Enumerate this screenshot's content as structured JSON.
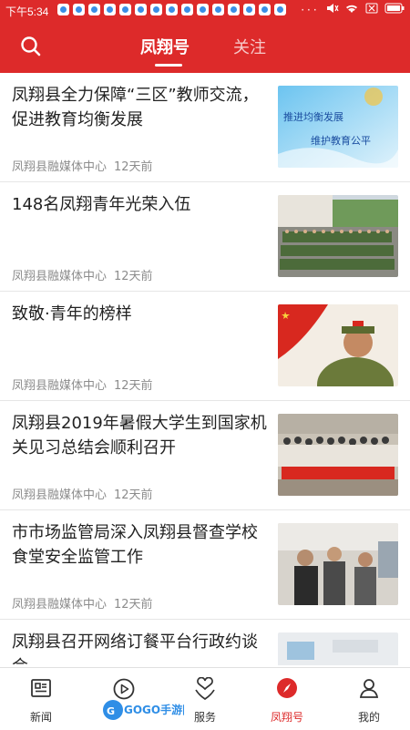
{
  "status_bar": {
    "time": "下午5:34",
    "notification_icons": [
      "app-notification-icon",
      "app-notification-icon",
      "app-notification-icon",
      "app-notification-icon",
      "app-notification-icon",
      "app-notification-icon",
      "app-notification-icon",
      "app-notification-icon",
      "app-notification-icon",
      "app-notification-icon",
      "app-notification-icon",
      "app-notification-icon",
      "app-notification-icon"
    ],
    "right_icons": [
      "more-icon",
      "mute-icon",
      "wifi-icon",
      "signal-off-icon",
      "battery-icon"
    ]
  },
  "header": {
    "search_icon": "search-icon",
    "tabs": [
      {
        "label": "凤翔号",
        "active": true
      },
      {
        "label": "关注",
        "active": false
      }
    ],
    "accent_color": "#dd2a2a"
  },
  "news": [
    {
      "title": "凤翔县全力保障“三区”教师交流，促进教育均衡发展",
      "source": "凤翔县融媒体中心",
      "time": "12天前",
      "thumb_text_1": "推进均衡发展",
      "thumb_text_2": "维护教育公平"
    },
    {
      "title": "148名凤翔青年光荣入伍",
      "source": "凤翔县融媒体中心",
      "time": "12天前"
    },
    {
      "title": "致敬·青年的榜样",
      "source": "凤翔县融媒体中心",
      "time": "12天前"
    },
    {
      "title": "凤翔县2019年暑假大学生到国家机关见习总结会顺利召开",
      "source": "凤翔县融媒体中心",
      "time": "12天前"
    },
    {
      "title": "市市场监管局深入凤翔县督查学校食堂安全监管工作",
      "source": "凤翔县融媒体中心",
      "time": "12天前"
    },
    {
      "title": "凤翔县召开网络订餐平台行政约谈会"
    }
  ],
  "bottom_nav": [
    {
      "label": "新闻",
      "icon": "newspaper-icon",
      "active": false
    },
    {
      "label": "",
      "icon": "video-play-icon",
      "active": false
    },
    {
      "label": "服务",
      "icon": "service-heart-icon",
      "active": false
    },
    {
      "label": "凤翔号",
      "icon": "compass-icon",
      "active": true
    },
    {
      "label": "我的",
      "icon": "profile-icon",
      "active": false
    }
  ],
  "watermark": {
    "text": "GOGO手游网"
  }
}
